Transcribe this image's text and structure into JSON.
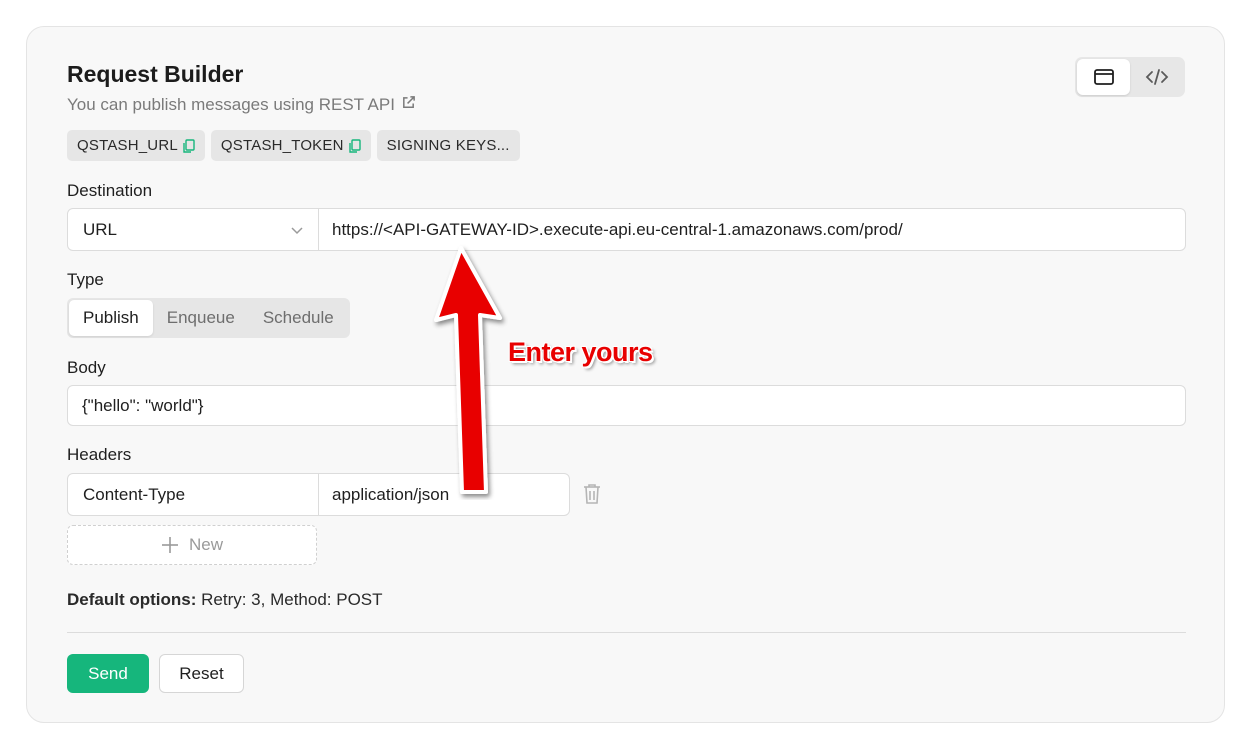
{
  "header": {
    "title": "Request Builder",
    "subtitle": "You can publish messages using REST API",
    "view_toggle": {
      "options": [
        "window-icon",
        "code-icon"
      ],
      "active": 0
    }
  },
  "chips": [
    {
      "label": "QSTASH_URL",
      "has_copy": true
    },
    {
      "label": "QSTASH_TOKEN",
      "has_copy": true
    },
    {
      "label": "SIGNING KEYS...",
      "has_copy": false
    }
  ],
  "destination": {
    "label": "Destination",
    "type_value": "URL",
    "url_value": "https://<API-GATEWAY-ID>.execute-api.eu-central-1.amazonaws.com/prod/"
  },
  "type": {
    "label": "Type",
    "options": [
      "Publish",
      "Enqueue",
      "Schedule"
    ],
    "active": "Publish"
  },
  "body": {
    "label": "Body",
    "value": "{\"hello\": \"world\"}"
  },
  "headers": {
    "label": "Headers",
    "rows": [
      {
        "key": "Content-Type",
        "value": "application/json"
      }
    ],
    "new_label": "New"
  },
  "defaults": {
    "prefix": "Default options:",
    "text": "Retry: 3, Method: POST"
  },
  "actions": {
    "send_label": "Send",
    "reset_label": "Reset"
  },
  "annotation": {
    "text": "Enter yours",
    "color": "#e80000"
  },
  "colors": {
    "accent": "#16b67c",
    "copy_icon": "#16b67c"
  }
}
